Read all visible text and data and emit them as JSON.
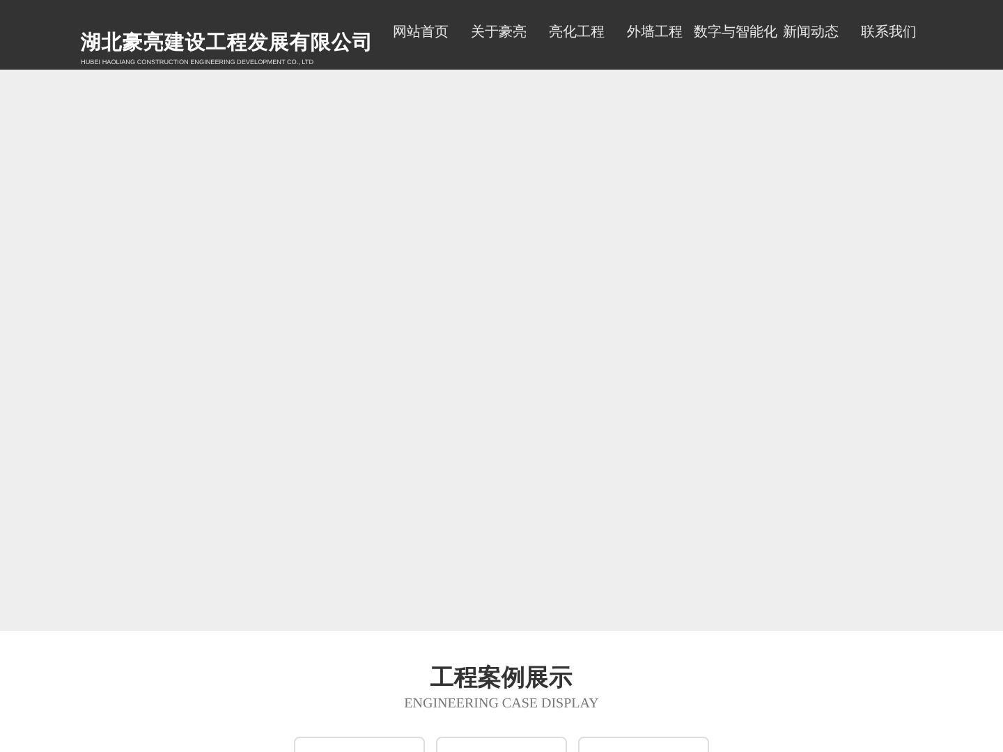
{
  "header": {
    "company_name": "湖北豪亮建设工程发展有限公司",
    "company_name_en": "HUBEI HAOLIANG CONSTRUCTION ENGINEERING DEVELOPMENT CO., LTD",
    "nav": [
      "网站首页",
      "关于豪亮",
      "亮化工程",
      "外墙工程",
      "数字与智能化",
      "新闻动态",
      "联系我们"
    ]
  },
  "section": {
    "title": "工程案例展示",
    "subtitle": "ENGINEERING CASE DISPLAY"
  }
}
